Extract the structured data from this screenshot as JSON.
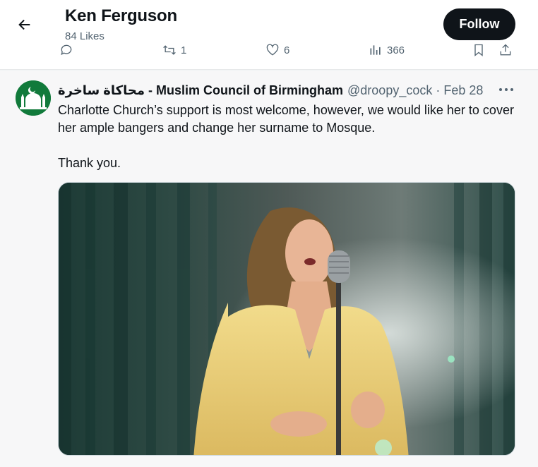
{
  "header": {
    "title": "Ken Ferguson",
    "subtitle": "84 Likes",
    "follow_label": "Follow"
  },
  "prev_tweet_actions": {
    "reply_count": "",
    "retweet_count": "1",
    "like_count": "6",
    "view_count": "366"
  },
  "tweet": {
    "display_name": "محاكاة ساخرة - Muslim Council of Birmingham",
    "handle": "@droopy_cock",
    "separator": "·",
    "date": "Feb 28",
    "text_line_1": "Charlotte Church’s support is most welcome, however, we would like her to cover her ample bangers and change her surname to Mosque.",
    "text_line_2": "Thank you."
  },
  "colors": {
    "follow_bg": "#0f1419",
    "muted": "#536471",
    "avatar_bg": "#117a3b"
  },
  "icons": [
    "back-arrow-icon",
    "reply-icon",
    "retweet-icon",
    "like-icon",
    "views-icon",
    "bookmark-icon",
    "share-icon",
    "more-icon",
    "mosque-icon"
  ]
}
